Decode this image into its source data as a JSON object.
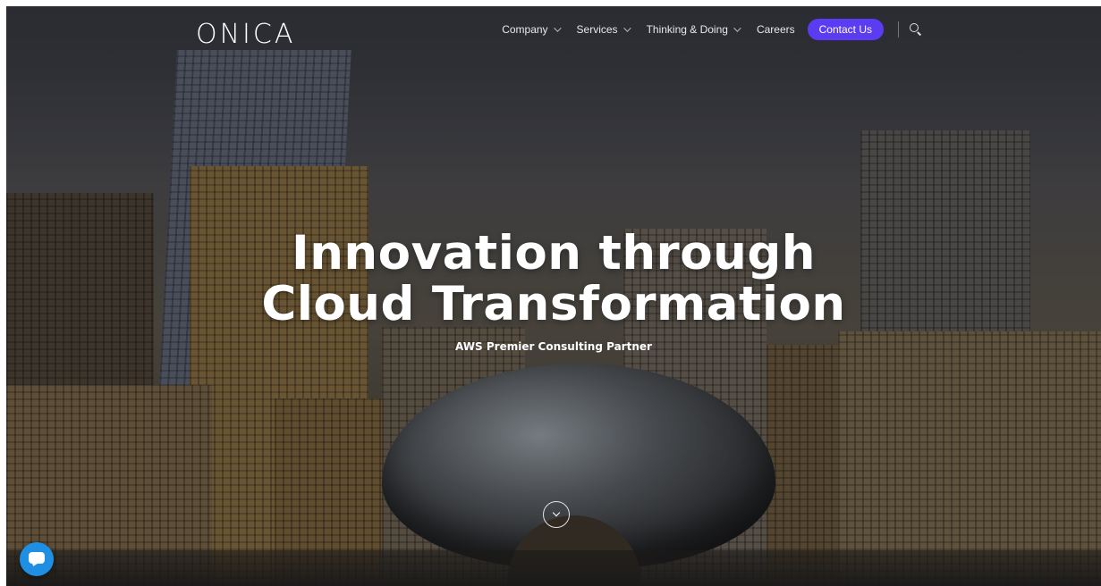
{
  "header": {
    "logo_text": "ONICA",
    "nav": {
      "company": "Company",
      "services": "Services",
      "thinking": "Thinking & Doing",
      "careers": "Careers",
      "contact": "Contact Us"
    }
  },
  "hero": {
    "title_line1": "Innovation through",
    "title_line2": "Cloud Transformation",
    "subtitle": "AWS Premier Consulting Partner"
  },
  "icons": {
    "search": "search-icon",
    "scroll": "chevron-down-icon",
    "chat": "chat-bubble-icon"
  },
  "colors": {
    "cta": "#5b3cf2",
    "chat": "#1e8fe3"
  }
}
